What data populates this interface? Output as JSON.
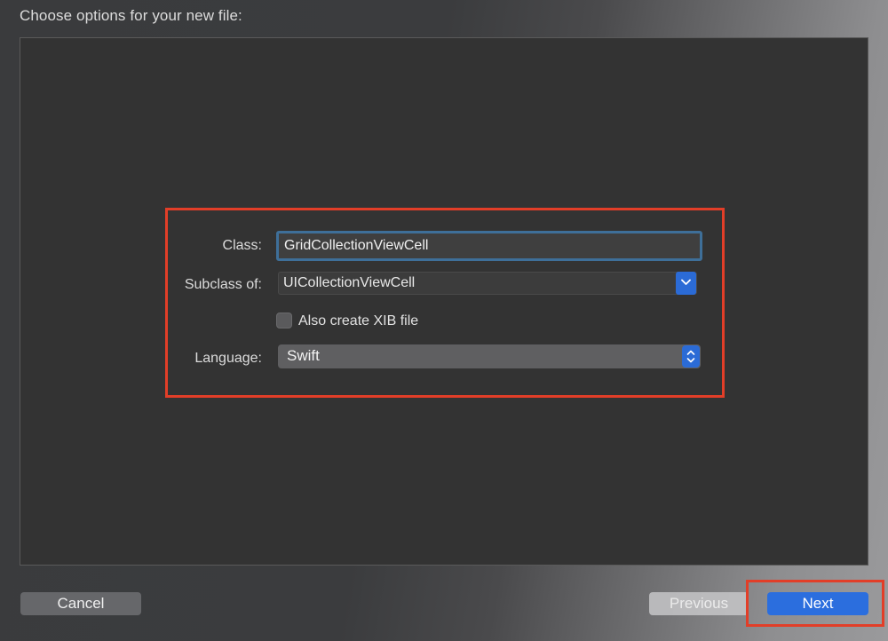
{
  "header": {
    "title": "Choose options for your new file:"
  },
  "form": {
    "class_label": "Class:",
    "class_value": "GridCollectionViewCell",
    "subclass_label": "Subclass of:",
    "subclass_value": "UICollectionViewCell",
    "xib_label": "Also create XIB file",
    "xib_checked": false,
    "language_label": "Language:",
    "language_value": "Swift"
  },
  "footer": {
    "cancel_label": "Cancel",
    "previous_label": "Previous",
    "next_label": "Next"
  },
  "icons": {
    "subclass_dropdown": "chevron-down-icon",
    "language_stepper": "up-down-chevron-icon"
  },
  "colors": {
    "accent": "#2b6ede",
    "highlight": "#e23e28",
    "panel": "#333333"
  }
}
